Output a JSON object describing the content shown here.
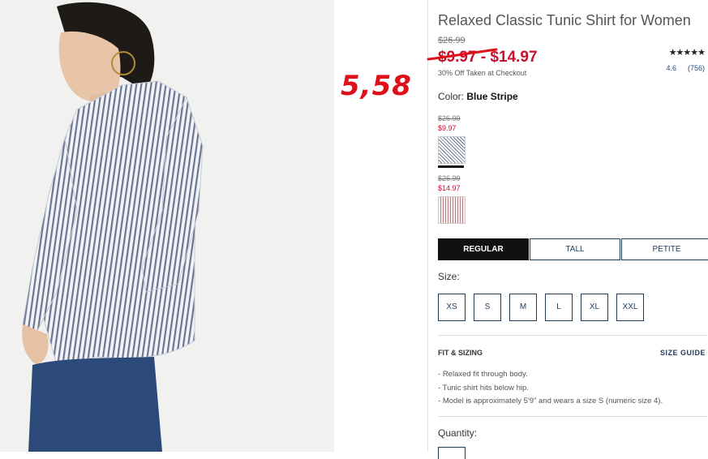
{
  "annotation": {
    "handwritten_price": "5,58"
  },
  "product": {
    "title": "Relaxed Classic Tunic Shirt for Women",
    "original_price": "$26.99",
    "sale_price_range": "$9.97 - $14.97",
    "promo": "30% Off Taken at Checkout",
    "rating": {
      "stars": "★★★★★",
      "score": "4.6",
      "count": "(756)"
    }
  },
  "color": {
    "label": "Color:",
    "selected": "Blue Stripe",
    "swatches": [
      {
        "orig": "$26.99",
        "sale": "$9.97",
        "name": "blue-stripe",
        "selected": true
      },
      {
        "orig": "$26.99",
        "sale": "$14.97",
        "name": "red-stripe",
        "selected": false
      }
    ]
  },
  "fit_tabs": [
    "REGULAR",
    "TALL",
    "PETITE"
  ],
  "size": {
    "label": "Size:",
    "options": [
      "XS",
      "S",
      "M",
      "L",
      "XL",
      "XXL"
    ]
  },
  "fit_sizing": {
    "heading": "FIT & SIZING",
    "guide_link": "SIZE GUIDE",
    "bullets": [
      "Relaxed fit through body.",
      "Tunic shirt hits below hip.",
      "Model is approximately 5'9\" and wears a size S (numeric size 4)."
    ]
  },
  "quantity": {
    "label": "Quantity:"
  },
  "colors": {
    "sale_red": "#c8102e",
    "annotation_red": "#e0101a",
    "navy": "#1f3b5a"
  }
}
